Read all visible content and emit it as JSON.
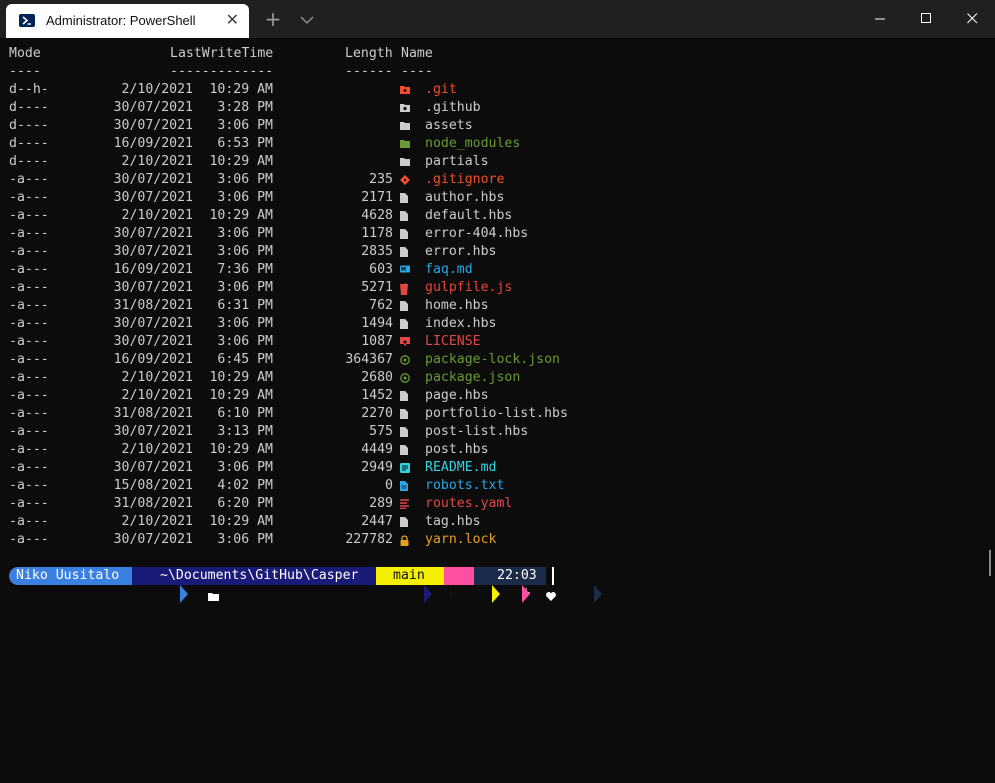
{
  "window": {
    "tab_title": "Administrator: PowerShell",
    "close_tab_glyph": "✕",
    "new_tab_glyph": "+",
    "icons": [
      "powershell-icon",
      "close-icon",
      "plus-icon",
      "chevron-down-icon",
      "minimize-icon",
      "maximize-icon",
      "close-window-icon"
    ]
  },
  "listing": {
    "headers": {
      "mode": "Mode",
      "lastwritetime": "LastWriteTime",
      "length": "Length",
      "name": "Name"
    },
    "underlines": {
      "mode": "----",
      "lastwritetime": "-------------",
      "length": "------",
      "name": "----"
    },
    "rows": [
      {
        "mode": "d--h-",
        "date": "2/10/2021",
        "time": "10:29 AM",
        "length": "",
        "name": ".git",
        "icon": "git-folder-icon",
        "color": "#f24e2a"
      },
      {
        "mode": "d----",
        "date": "30/07/2021",
        "time": "3:28 PM",
        "length": "",
        "name": ".github",
        "icon": "github-folder-icon",
        "color": "#cccccc"
      },
      {
        "mode": "d----",
        "date": "30/07/2021",
        "time": "3:06 PM",
        "length": "",
        "name": "assets",
        "icon": "folder-icon",
        "color": "#cccccc"
      },
      {
        "mode": "d----",
        "date": "16/09/2021",
        "time": "6:53 PM",
        "length": "",
        "name": "node_modules",
        "icon": "node-folder-icon",
        "color": "#6a9a34"
      },
      {
        "mode": "d----",
        "date": "2/10/2021",
        "time": "10:29 AM",
        "length": "",
        "name": "partials",
        "icon": "folder-icon",
        "color": "#cccccc"
      },
      {
        "mode": "-a---",
        "date": "30/07/2021",
        "time": "3:06 PM",
        "length": "235",
        "name": ".gitignore",
        "icon": "git-icon",
        "color": "#f24e2a"
      },
      {
        "mode": "-a---",
        "date": "30/07/2021",
        "time": "3:06 PM",
        "length": "2171",
        "name": "author.hbs",
        "icon": "file-icon",
        "color": "#cccccc"
      },
      {
        "mode": "-a---",
        "date": "2/10/2021",
        "time": "10:29 AM",
        "length": "4628",
        "name": "default.hbs",
        "icon": "file-icon",
        "color": "#cccccc"
      },
      {
        "mode": "-a---",
        "date": "30/07/2021",
        "time": "3:06 PM",
        "length": "1178",
        "name": "error-404.hbs",
        "icon": "file-icon",
        "color": "#cccccc"
      },
      {
        "mode": "-a---",
        "date": "30/07/2021",
        "time": "3:06 PM",
        "length": "2835",
        "name": "error.hbs",
        "icon": "file-icon",
        "color": "#cccccc"
      },
      {
        "mode": "-a---",
        "date": "16/09/2021",
        "time": "7:36 PM",
        "length": "603",
        "name": "faq.md",
        "icon": "markdown-icon",
        "color": "#29a7e6"
      },
      {
        "mode": "-a---",
        "date": "30/07/2021",
        "time": "3:06 PM",
        "length": "5271",
        "name": "gulpfile.js",
        "icon": "gulp-icon",
        "color": "#e04840"
      },
      {
        "mode": "-a---",
        "date": "31/08/2021",
        "time": "6:31 PM",
        "length": "762",
        "name": "home.hbs",
        "icon": "file-icon",
        "color": "#cccccc"
      },
      {
        "mode": "-a---",
        "date": "30/07/2021",
        "time": "3:06 PM",
        "length": "1494",
        "name": "index.hbs",
        "icon": "file-icon",
        "color": "#cccccc"
      },
      {
        "mode": "-a---",
        "date": "30/07/2021",
        "time": "3:06 PM",
        "length": "1087",
        "name": "LICENSE",
        "icon": "license-icon",
        "color": "#e04848"
      },
      {
        "mode": "-a---",
        "date": "16/09/2021",
        "time": "6:45 PM",
        "length": "364367",
        "name": "package-lock.json",
        "icon": "npm-icon",
        "color": "#6a9a34"
      },
      {
        "mode": "-a---",
        "date": "2/10/2021",
        "time": "10:29 AM",
        "length": "2680",
        "name": "package.json",
        "icon": "npm-icon",
        "color": "#6a9a34"
      },
      {
        "mode": "-a---",
        "date": "2/10/2021",
        "time": "10:29 AM",
        "length": "1452",
        "name": "page.hbs",
        "icon": "file-icon",
        "color": "#cccccc"
      },
      {
        "mode": "-a---",
        "date": "31/08/2021",
        "time": "6:10 PM",
        "length": "2270",
        "name": "portfolio-list.hbs",
        "icon": "file-icon",
        "color": "#cccccc"
      },
      {
        "mode": "-a---",
        "date": "30/07/2021",
        "time": "3:13 PM",
        "length": "575",
        "name": "post-list.hbs",
        "icon": "file-icon",
        "color": "#cccccc"
      },
      {
        "mode": "-a---",
        "date": "2/10/2021",
        "time": "10:29 AM",
        "length": "4449",
        "name": "post.hbs",
        "icon": "file-icon",
        "color": "#cccccc"
      },
      {
        "mode": "-a---",
        "date": "30/07/2021",
        "time": "3:06 PM",
        "length": "2949",
        "name": "README.md",
        "icon": "readme-icon",
        "color": "#2fd4e0"
      },
      {
        "mode": "-a---",
        "date": "15/08/2021",
        "time": "4:02 PM",
        "length": "0",
        "name": "robots.txt",
        "icon": "text-file-icon",
        "color": "#29a7e6"
      },
      {
        "mode": "-a---",
        "date": "31/08/2021",
        "time": "6:20 PM",
        "length": "289",
        "name": "routes.yaml",
        "icon": "yaml-icon",
        "color": "#e04848"
      },
      {
        "mode": "-a---",
        "date": "2/10/2021",
        "time": "10:29 AM",
        "length": "2447",
        "name": "tag.hbs",
        "icon": "file-icon",
        "color": "#cccccc"
      },
      {
        "mode": "-a---",
        "date": "30/07/2021",
        "time": "3:06 PM",
        "length": "227782",
        "name": "yarn.lock",
        "icon": "lock-icon",
        "color": "#e5a020"
      }
    ]
  },
  "prompt": {
    "user": "Niko Uusitalo",
    "path": "~\\Documents\\GitHub\\Casper",
    "branch": "main",
    "time": "22:03",
    "colors": {
      "user": "#3a80e0",
      "path": "#1a1a78",
      "branch": "#f4f000",
      "status": "#ff4fa0",
      "time": "#1c2b4a"
    }
  }
}
